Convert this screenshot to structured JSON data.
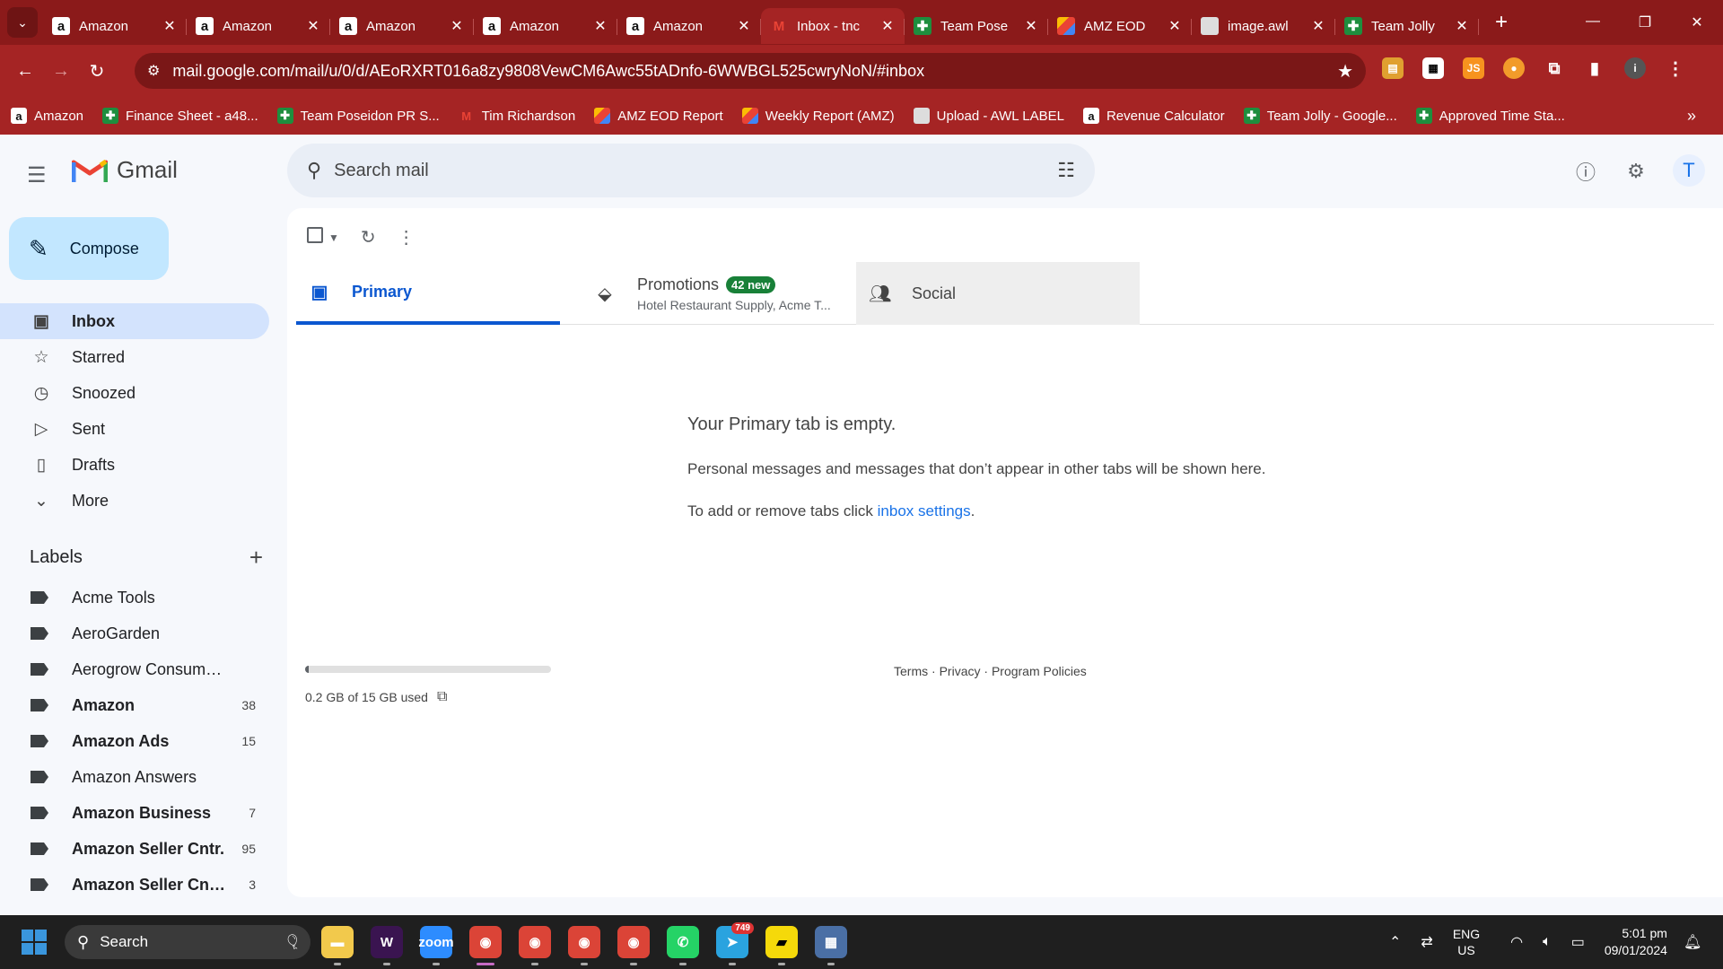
{
  "browser": {
    "tabs": [
      {
        "label": "Amazon",
        "icon": "amazon"
      },
      {
        "label": "Amazon",
        "icon": "amazon"
      },
      {
        "label": "Amazon",
        "icon": "amazon"
      },
      {
        "label": "Amazon",
        "icon": "amazon"
      },
      {
        "label": "Amazon",
        "icon": "amazon"
      },
      {
        "label": "Inbox - tnc",
        "icon": "gmail",
        "active": true
      },
      {
        "label": "Team Pose",
        "icon": "sheets"
      },
      {
        "label": "AMZ EOD",
        "icon": "colors"
      },
      {
        "label": "image.awl",
        "icon": "awl"
      },
      {
        "label": "Team Jolly",
        "icon": "sheets"
      }
    ],
    "url": "mail.google.com/mail/u/0/d/AEoRXRT016a8zy9808VewCM6Awc55tADnfo-6WWBGL525cwryNoN/#inbox",
    "bookmarks": [
      {
        "label": "Amazon",
        "icon": "amazon"
      },
      {
        "label": "Finance Sheet - a48...",
        "icon": "sheets"
      },
      {
        "label": "Team Poseidon PR S...",
        "icon": "sheets"
      },
      {
        "label": "Tim Richardson",
        "icon": "gmail"
      },
      {
        "label": "AMZ EOD Report",
        "icon": "colors"
      },
      {
        "label": "Weekly Report (AMZ)",
        "icon": "colors"
      },
      {
        "label": "Upload - AWL LABEL",
        "icon": "awl"
      },
      {
        "label": "Revenue Calculator",
        "icon": "amazon"
      },
      {
        "label": "Team Jolly - Google...",
        "icon": "sheets"
      },
      {
        "label": "Approved Time Sta...",
        "icon": "sheets"
      }
    ],
    "colors": {
      "chrome": "#8b1a1a",
      "toolbar": "#a52424"
    }
  },
  "gmail": {
    "brand": "Gmail",
    "search_placeholder": "Search mail",
    "avatar_letter": "T",
    "compose_label": "Compose",
    "nav": [
      {
        "label": "Inbox",
        "icon": "inbox-icon",
        "glyph": "▣",
        "active": true
      },
      {
        "label": "Starred",
        "icon": "star-icon",
        "glyph": "☆"
      },
      {
        "label": "Snoozed",
        "icon": "clock-icon",
        "glyph": "◷"
      },
      {
        "label": "Sent",
        "icon": "send-icon",
        "glyph": "▷"
      },
      {
        "label": "Drafts",
        "icon": "draft-icon",
        "glyph": "▯"
      },
      {
        "label": "More",
        "icon": "chevron-down-icon",
        "glyph": "⌄"
      }
    ],
    "labels_title": "Labels",
    "labels": [
      {
        "name": "Acme Tools",
        "count": "",
        "bold": false
      },
      {
        "name": "AeroGarden",
        "count": "",
        "bold": false
      },
      {
        "name": "Aerogrow Consumer Se...",
        "count": "",
        "bold": false
      },
      {
        "name": "Amazon",
        "count": "38",
        "bold": true
      },
      {
        "name": "Amazon Ads",
        "count": "15",
        "bold": true
      },
      {
        "name": "Amazon Answers",
        "count": "",
        "bold": false
      },
      {
        "name": "Amazon Business",
        "count": "7",
        "bold": true
      },
      {
        "name": "Amazon Seller Cntr.",
        "count": "95",
        "bold": true
      },
      {
        "name": "Amazon Seller Cntr...",
        "count": "3",
        "bold": true
      }
    ],
    "category_tabs": {
      "primary": "Primary",
      "promotions": "Promotions",
      "promotions_badge": "42 new",
      "promotions_snippet": "Hotel Restaurant Supply, Acme T...",
      "social": "Social"
    },
    "empty_state": {
      "title": "Your Primary tab is empty.",
      "message": "Personal messages and messages that don’t appear in other tabs will be shown here.",
      "settings_prefix": "To add or remove tabs click ",
      "settings_link": "inbox settings",
      "settings_suffix": "."
    },
    "storage": {
      "text": "0.2 GB of 15 GB used",
      "used_fraction": 0.013
    },
    "footer": {
      "terms": "Terms",
      "privacy": "Privacy",
      "policies": "Program Policies",
      "separator": " · "
    },
    "colors": {
      "accent": "#0b57d0",
      "badge": "#188038",
      "active_nav": "#d3e3fd",
      "compose": "#c2e7ff"
    }
  },
  "taskbar": {
    "search_label": "Search",
    "apps": [
      {
        "name": "file-explorer",
        "glyph": "▬",
        "color": "#f2c94c"
      },
      {
        "name": "winamp",
        "glyph": "W",
        "color": "#3a1450"
      },
      {
        "name": "zoom",
        "glyph": "zoom",
        "color": "#2d8cff"
      },
      {
        "name": "chrome-profile-1",
        "glyph": "◉",
        "color": "#db4437",
        "current": true
      },
      {
        "name": "chrome-profile-2",
        "glyph": "◉",
        "color": "#db4437"
      },
      {
        "name": "chrome-profile-3",
        "glyph": "◉",
        "color": "#db4437"
      },
      {
        "name": "chrome-profile-4",
        "glyph": "◉",
        "color": "#db4437"
      },
      {
        "name": "whatsapp",
        "glyph": "✆",
        "color": "#25d366"
      },
      {
        "name": "telegram",
        "glyph": "➤",
        "color": "#2aa3df",
        "badge": "749"
      },
      {
        "name": "sticky-notes",
        "glyph": "▰",
        "color": "#f5d90a"
      },
      {
        "name": "calculator",
        "glyph": "▦",
        "color": "#4a6fa5"
      }
    ],
    "language": "ENG",
    "region": "US",
    "time": "5:01 pm",
    "date": "09/01/2024"
  }
}
